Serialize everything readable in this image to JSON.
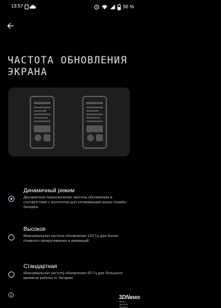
{
  "status_bar": {
    "time": "13:57",
    "battery_text": "56 %",
    "left_icons": [
      "notification-icon",
      "cloud-icon"
    ],
    "right_icons": [
      "alarm-icon",
      "wifi-icon",
      "signal-icon",
      "battery-icon"
    ]
  },
  "header": {
    "back_icon": "arrow-left-icon",
    "title": "ЧАСТОТА ОБНОВЛЕНИЯ ЭКРАНА"
  },
  "options": [
    {
      "title": "Динамичный режим",
      "description": "Динамичное переключение частоты обновления в соответствии с контентом для оптимизации срока службы батареи.",
      "selected": true
    },
    {
      "title": "Высокое",
      "description": "Максимальная частота обновления 120 Гц для более плавного прокручивания и анимаций.",
      "selected": false
    },
    {
      "title": "Стандартная",
      "description": "Максимальная частота обновления 60 Гц для большего времени работы от батареи.",
      "selected": false
    }
  ],
  "footer": {
    "info_icon": "info-icon"
  },
  "watermark": {
    "logo": "3DNews",
    "tagline": "DAILY DIGITAL DIGEST"
  },
  "colors": {
    "background": "#000000",
    "accent": "#c5cdf7",
    "card": "#1e1e1e"
  }
}
